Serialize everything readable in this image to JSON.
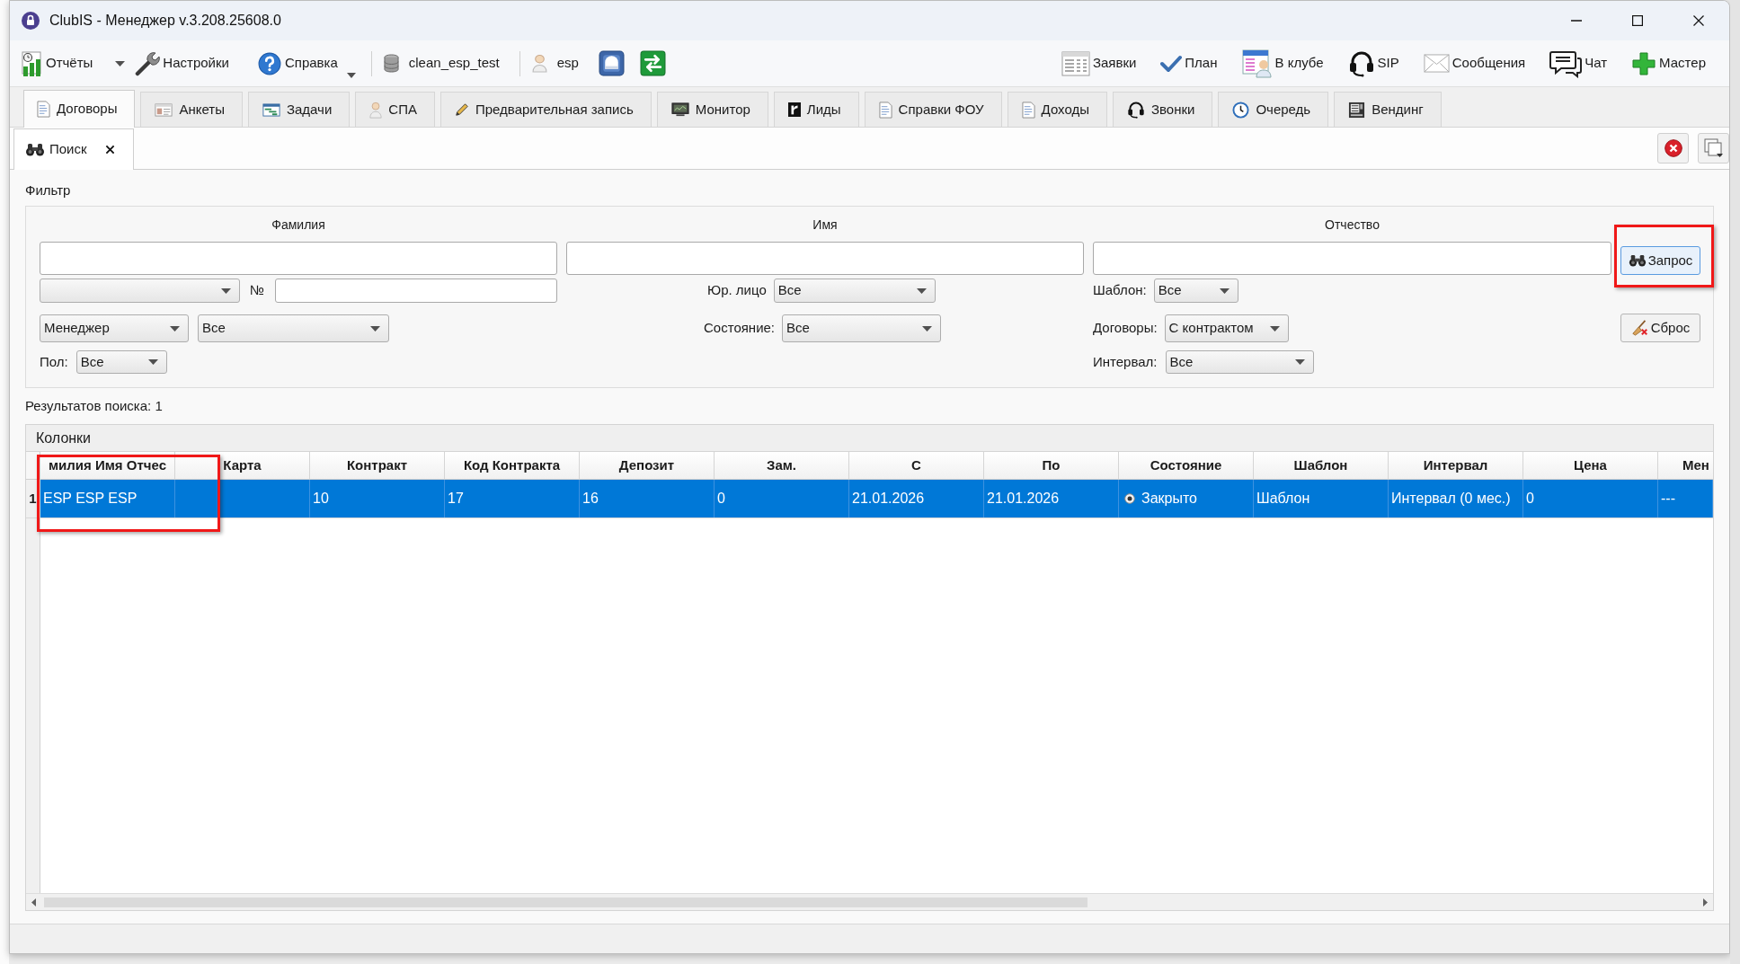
{
  "window": {
    "title": "ClubIS - Менеджер v.3.208.25608.0"
  },
  "toolbar": {
    "left": [
      {
        "kind": "split",
        "label": "Отчёты"
      },
      {
        "kind": "button",
        "label": "Настройки"
      },
      {
        "kind": "menu",
        "label": "Справка"
      },
      {
        "kind": "info",
        "label": "clean_esp_test"
      },
      {
        "kind": "info",
        "label": "esp"
      },
      {
        "kind": "icon"
      },
      {
        "kind": "icon"
      }
    ],
    "right": [
      {
        "label": "Заявки"
      },
      {
        "label": "План"
      },
      {
        "label": "В клубе"
      },
      {
        "label": "SIP"
      },
      {
        "label": "Сообщения"
      },
      {
        "label": "Чат"
      },
      {
        "label": "Мастер"
      }
    ]
  },
  "tabs": [
    {
      "label": "Договоры",
      "selected": true
    },
    {
      "label": "Анкеты",
      "selected": false
    },
    {
      "label": "Задачи",
      "selected": false
    },
    {
      "label": "СПА",
      "selected": false
    },
    {
      "label": "Предварительная запись",
      "selected": false
    },
    {
      "label": "Монитор",
      "selected": false
    },
    {
      "label": "Лиды",
      "selected": false
    },
    {
      "label": "Справки ФОУ",
      "selected": false
    },
    {
      "label": "Доходы",
      "selected": false
    },
    {
      "label": "Звонки",
      "selected": false
    },
    {
      "label": "Очередь",
      "selected": false
    },
    {
      "label": "Вендинг",
      "selected": false
    }
  ],
  "subtabs": [
    {
      "label": "Поиск",
      "selected": true
    }
  ],
  "filter": {
    "title": "Фильтр",
    "name_fields": [
      {
        "label": "Фамилия"
      },
      {
        "label": "Имя"
      },
      {
        "label": "Отчество"
      }
    ],
    "number_field": {
      "label": "№"
    },
    "legal_entity": {
      "label": "Юр. лицо",
      "value": "Все"
    },
    "template": {
      "label": "Шаблон:",
      "value": "Все"
    },
    "manager_type": {
      "value": "Менеджер"
    },
    "manager": {
      "value": "Все"
    },
    "state": {
      "label": "Состояние:",
      "value": "Все"
    },
    "contracts": {
      "label": "Договоры:",
      "value": "С контрактом"
    },
    "gender": {
      "label": "Пол:",
      "value": "Все"
    },
    "interval": {
      "label": "Интервал:",
      "value": "Все"
    },
    "query_button": {
      "label": "Запрос",
      "focused": true,
      "highlighted": true
    },
    "reset_button": {
      "label": "Сброс",
      "focused": false,
      "highlighted": false
    }
  },
  "search_results": "Результатов поиска: 1",
  "table": {
    "panel_title": "Колонки",
    "columns": [
      "милия Имя Отчес",
      "Карта",
      "Контракт",
      "Код Контракта",
      "Депозит",
      "Зам.",
      "С",
      "По",
      "Состояние",
      "Шаблон",
      "Интервал",
      "Цена",
      "Мен"
    ],
    "rows": [
      {
        "number": "1",
        "selected": true,
        "cells": [
          {
            "kind": "text",
            "text": "ESP ESP ESP",
            "highlighted": true
          },
          {
            "kind": "text",
            "highlighted": false
          },
          {
            "kind": "text",
            "text": "10",
            "highlighted": false
          },
          {
            "kind": "text",
            "text": "17",
            "highlighted": false
          },
          {
            "kind": "text",
            "text": "16",
            "highlighted": false
          },
          {
            "kind": "text",
            "text": "0",
            "highlighted": false
          },
          {
            "kind": "text",
            "text": "21.01.2026",
            "highlighted": false
          },
          {
            "kind": "text",
            "text": "21.01.2026",
            "highlighted": false
          },
          {
            "kind": "status",
            "text": "Закрыто",
            "highlighted": false
          },
          {
            "kind": "text",
            "text": "Шаблон",
            "highlighted": false
          },
          {
            "kind": "text",
            "text": "Интервал (0 мес.)",
            "highlighted": false
          },
          {
            "kind": "text",
            "text": "0",
            "highlighted": false
          },
          {
            "kind": "text",
            "text": "---",
            "highlighted": false
          }
        ]
      }
    ]
  }
}
